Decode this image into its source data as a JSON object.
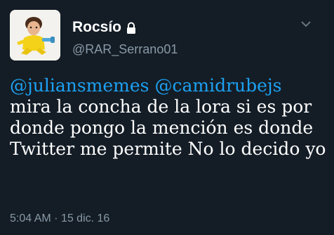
{
  "tweet": {
    "display_name": "Rocsío",
    "handle": "@RAR_Serrano01",
    "mention_1": "@juliansmemes",
    "mention_2": "@camidrubejs",
    "body_text": "mira la concha de la lora si es por donde pongo la mención es donde Twitter me permite No lo decido yo",
    "time": "5:04 AM",
    "separator": "·",
    "date": "15 dic. 16",
    "icons": {
      "lock": "lock-icon",
      "chevron": "chevron-down-icon",
      "avatar": "avatar"
    },
    "colors": {
      "background": "#141d26",
      "mention": "#1da1f2",
      "secondary": "#8899a6",
      "text": "#ffffff"
    }
  }
}
